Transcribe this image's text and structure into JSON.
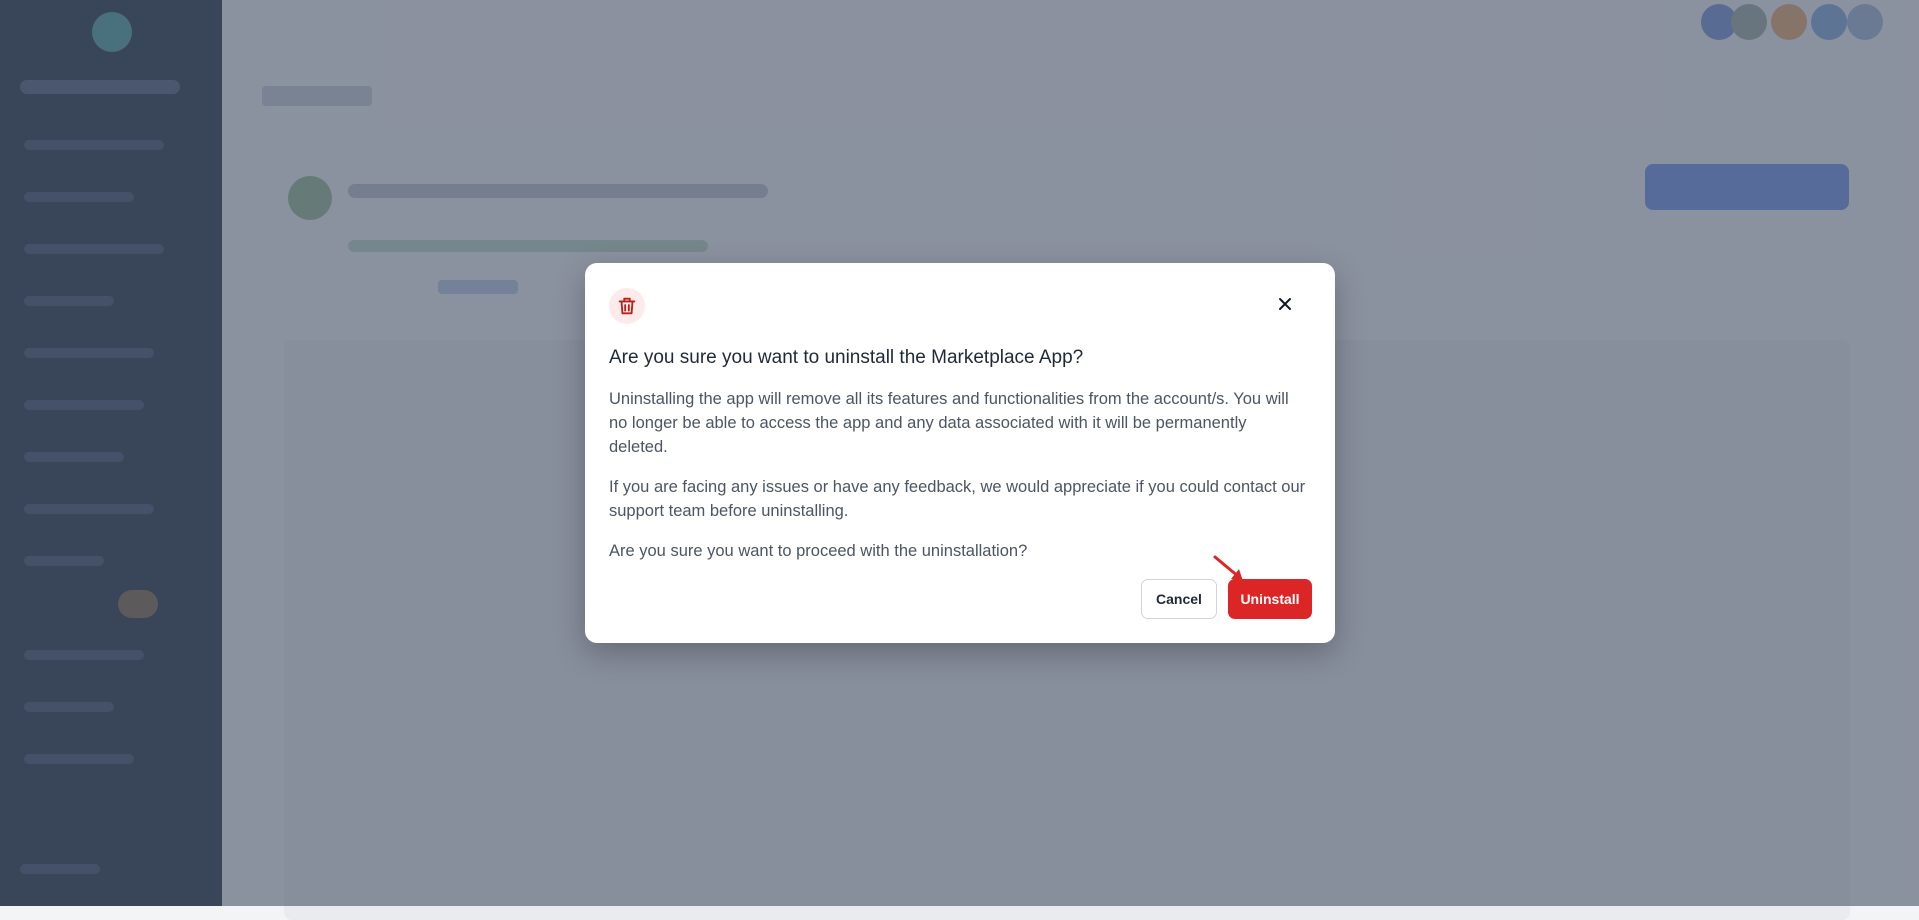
{
  "modal": {
    "title": "Are you sure you want to uninstall the Marketplace App?",
    "paragraph_1": "Uninstalling the app will remove all its features and functionalities from the account/s. You will no longer be able to access the app and any data associated with it will be permanently deleted.",
    "paragraph_2": "If you are facing any issues or have any feedback, we would appreciate if you could contact our support team before uninstalling.",
    "paragraph_3": "Are you sure you want to proceed with the uninstallation?",
    "cancel_label": "Cancel",
    "uninstall_label": "Uninstall",
    "icon": "trash-icon",
    "close_icon": "close-icon"
  },
  "colors": {
    "danger": "#dc2626",
    "overlay": "#4b5569",
    "sidebar": "#1f2a3e"
  }
}
